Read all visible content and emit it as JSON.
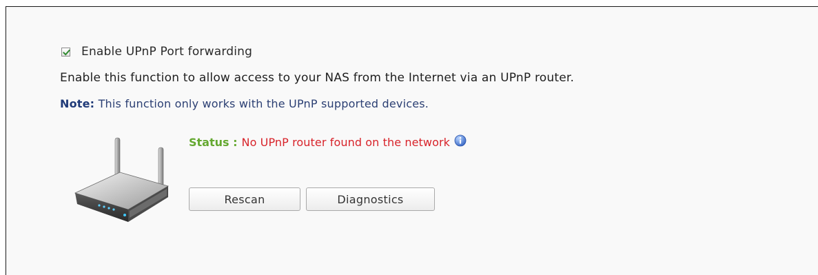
{
  "upnp": {
    "enable_checked": true,
    "enable_label": "Enable UPnP Port forwarding",
    "description": "Enable this function to allow access to your NAS from the Internet via an UPnP router.",
    "note_label": "Note:",
    "note_text": " This function only works with the UPnP supported devices.",
    "status_label": "Status :",
    "status_value": "No UPnP router found on the network",
    "buttons": {
      "rescan": "Rescan",
      "diagnostics": "Diagnostics"
    }
  },
  "icons": {
    "checkbox": "check-icon",
    "info": "info-icon",
    "router": "router-icon"
  },
  "colors": {
    "status_label": "#64a830",
    "status_value": "#d8232a",
    "note": "#1f3a78",
    "info_icon": "#3a6fd0"
  }
}
